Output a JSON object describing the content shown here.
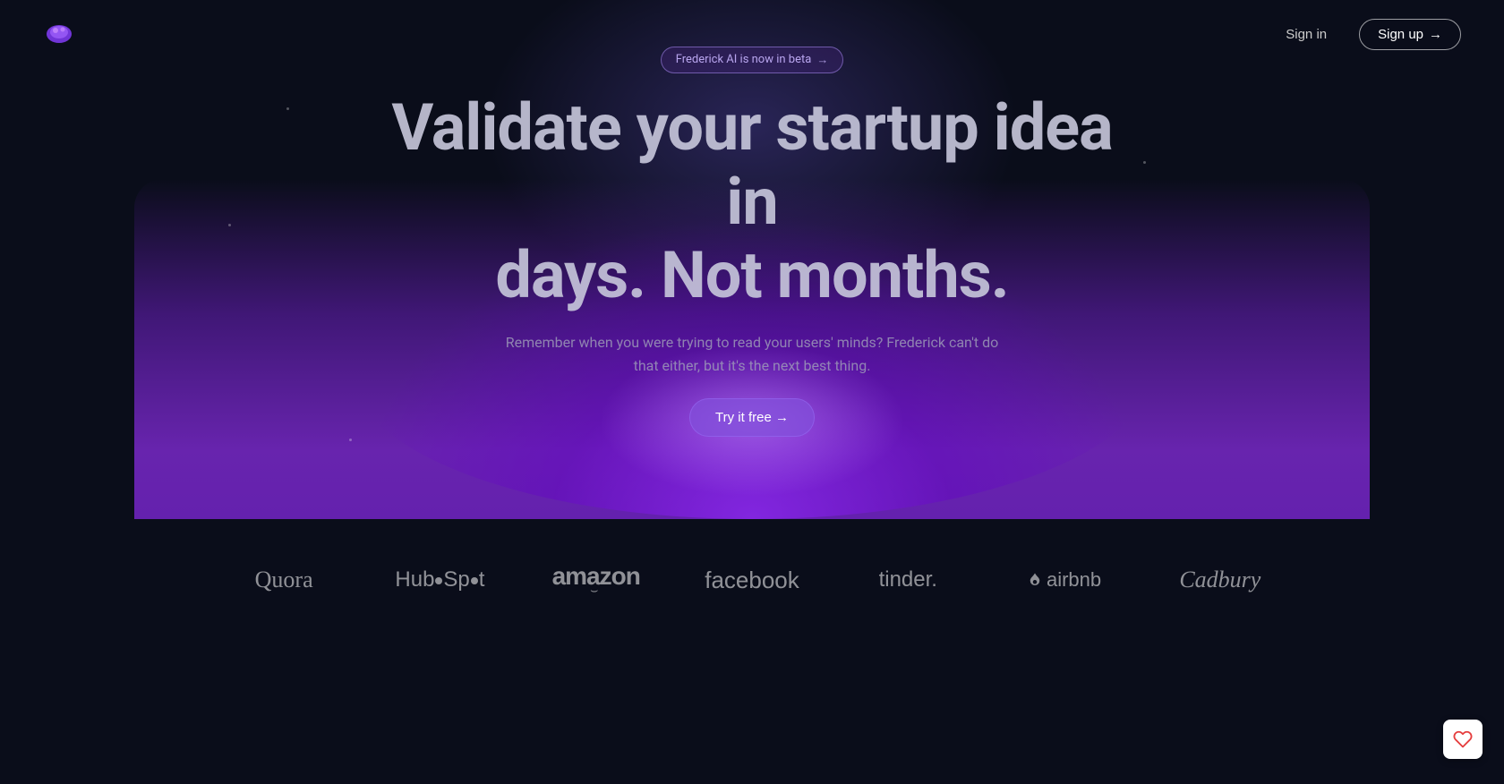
{
  "nav": {
    "sign_in_label": "Sign in",
    "sign_up_label": "Sign up",
    "sign_up_arrow": "→"
  },
  "hero": {
    "beta_badge_text": "Frederick AI is now in beta",
    "beta_badge_arrow": "→",
    "title_line1": "Validate your startup idea in",
    "title_line2": "days. Not months.",
    "subtitle": "Remember when you were trying to read your users' minds? Frederick can't do that either, but it's the next best thing.",
    "cta_label": "Try it free →"
  },
  "logos": {
    "items": [
      {
        "name": "Quora",
        "class": "logo-quora"
      },
      {
        "name": "HubSpot",
        "class": "logo-hubspot"
      },
      {
        "name": "amazon",
        "class": "logo-amazon"
      },
      {
        "name": "facebook",
        "class": "logo-facebook"
      },
      {
        "name": "tinder.",
        "class": "logo-tinder"
      },
      {
        "name": "airbnb",
        "class": "logo-airbnb"
      },
      {
        "name": "Cadbury",
        "class": "logo-cadbury"
      }
    ]
  },
  "colors": {
    "bg": "#0a0d1a",
    "accent_purple": "#7c3aed",
    "glow_purple": "#8b2be2",
    "text_muted": "rgba(160,160,185,0.8)",
    "logo_color": "rgba(255,255,255,0.55)"
  }
}
